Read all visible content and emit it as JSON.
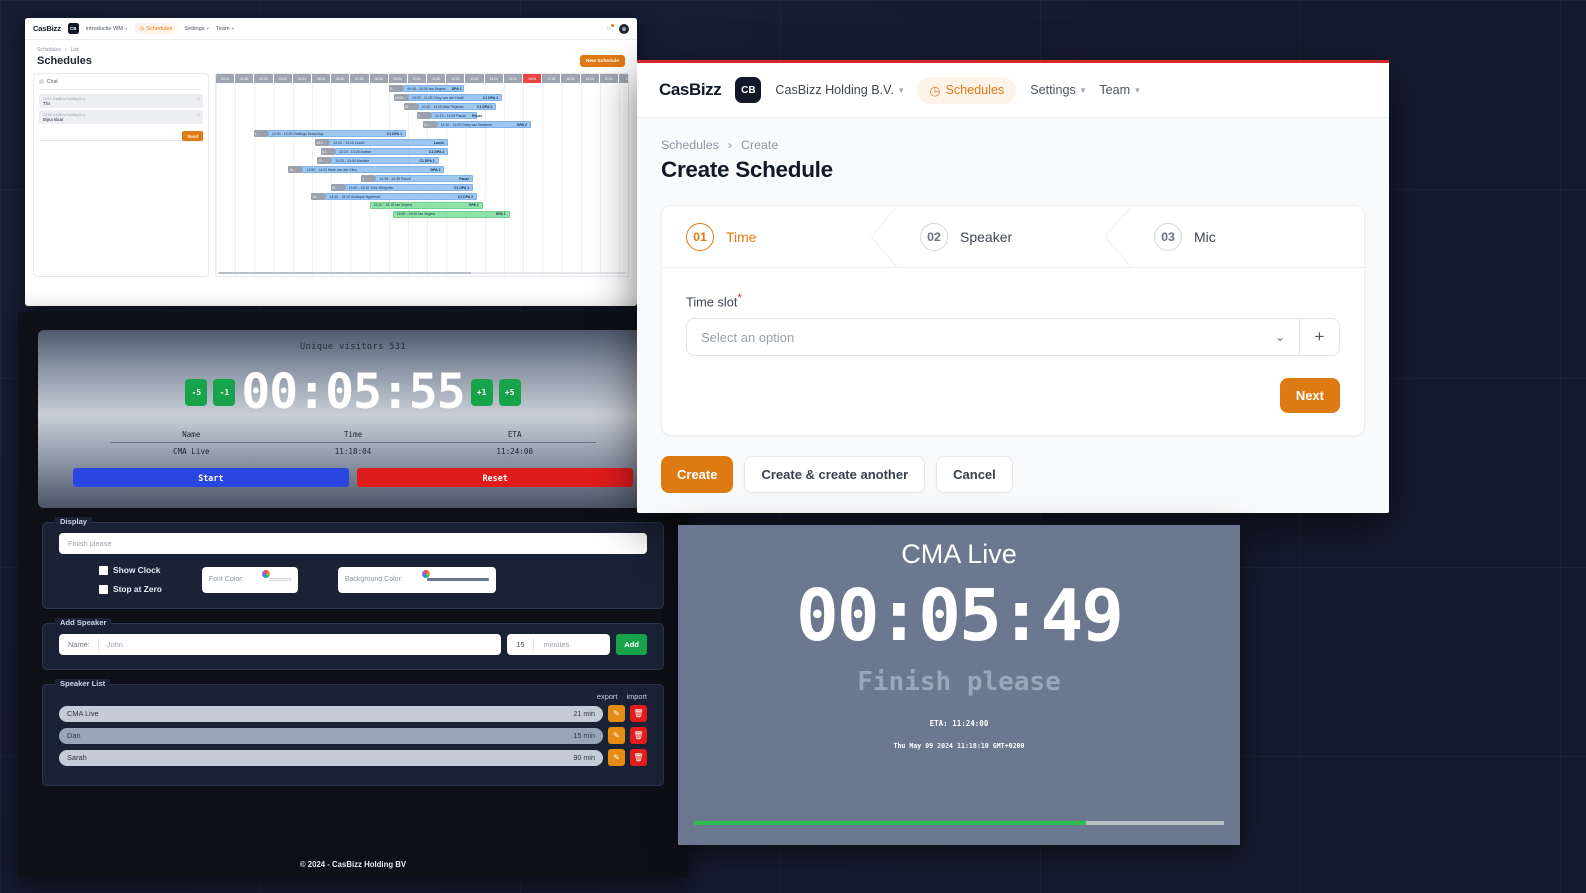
{
  "schedules_window": {
    "nav": {
      "logo": "CasBizz",
      "org_initials": "CB",
      "org_name": "introductie WM",
      "items": [
        {
          "label": "Schedules",
          "icon": "clock-icon",
          "active": true
        },
        {
          "label": "Settings",
          "icon": "chevron-down-icon",
          "active": false
        },
        {
          "label": "Team",
          "icon": "chevron-down-icon",
          "active": false
        }
      ],
      "bell_icon": "bell-icon",
      "avatar_icon": "avatar-icon"
    },
    "breadcrumb": [
      "Schedules",
      "List"
    ],
    "page_title": "Schedules",
    "new_button": "New Schedule",
    "chat": {
      "header": "Chat",
      "messages": [
        {
          "meta": "12:17 CasBizz Holding B.V.",
          "text": "Thx"
        },
        {
          "meta": "12:59 CasBizz Holding B.V.",
          "text": "Bijna klaar"
        }
      ],
      "send_label": "Send",
      "input_placeholder": ""
    },
    "gantt": {
      "ruler": [
        "00:00",
        "01:00",
        "02:00",
        "03:00",
        "04:00",
        "05:00",
        "06:00",
        "07:00",
        "08:00",
        "09:00",
        "10:00",
        "11:00",
        "12:00",
        "13:00",
        "14:00",
        "15:00",
        "16:05",
        "17:00",
        "18:00",
        "19:00",
        "20:00",
        "21:"
      ],
      "now_tick_index": 16,
      "rows": [
        {
          "label": "09:45 - 10:00 Ian Segers",
          "room": "DPA 1",
          "start": 9.75,
          "end": 12.9,
          "color": "blue",
          "handle": "0..."
        },
        {
          "label": "10:00 - 11:00 Choy van der Hooft",
          "room": "C1 DPA 1",
          "start": 10.0,
          "end": 14.9,
          "color": "blue",
          "handle": "10:00…"
        },
        {
          "label": "10:50 - 11:00 Alan Teljkovic",
          "room": "C1 DPA 2",
          "start": 10.5,
          "end": 14.6,
          "color": "blue",
          "handle": "10:…"
        },
        {
          "label": "11:15 - 11:30 Pauze",
          "room": "Pauze",
          "start": 11.2,
          "end": 13.6,
          "color": "blue",
          "handle": "1…"
        },
        {
          "label": "11:30 - 12:00 Gaby van Kesteren",
          "room": "DPA 2",
          "start": 11.5,
          "end": 16.4,
          "color": "blue",
          "handle": "11:…"
        },
        {
          "label": "12:00 - 12:20 Soelingo Rosschop",
          "room": "C1 DPA 1",
          "start": 2.7,
          "end": 9.9,
          "color": "blue",
          "handle": "1…"
        },
        {
          "label": "12:20 - 13:10 Lunch",
          "room": "Lunch",
          "start": 5.9,
          "end": 12.1,
          "color": "blue",
          "handle": "13:2…"
        },
        {
          "label": "13:10 - 13:20 Anieke",
          "room": "C1 DPA 2",
          "start": 6.2,
          "end": 12.1,
          "color": "blue",
          "handle": "13…"
        },
        {
          "label": "13:20 - 13:50 Marieke",
          "room": "C1 DPA 1",
          "start": 6.0,
          "end": 11.6,
          "color": "blue",
          "handle": "13:…"
        },
        {
          "label": "13:50 - 14:20 Mark van der Vlies",
          "room": "DPA 2",
          "start": 4.5,
          "end": 11.9,
          "color": "blue",
          "handle": "15…"
        },
        {
          "label": "14:25 - 14:35 Pauze",
          "room": "Pauze",
          "start": 8.3,
          "end": 13.4,
          "color": "blue",
          "handle": "1"
        },
        {
          "label": "14:40 - 15:10 Joris Werpelen",
          "room": "C1 DPA 1",
          "start": 6.7,
          "end": 13.4,
          "color": "blue",
          "handle": "14…"
        },
        {
          "label": "14:40 - 15:10 Siddique Ngadimin",
          "room": "C1 DPA 2",
          "start": 5.7,
          "end": 13.6,
          "color": "blue",
          "handle": "14…"
        },
        {
          "label": "15:10 - 15:15 Ian Segers",
          "room": "DPA 1",
          "start": 8.0,
          "end": 13.9,
          "color": "green",
          "handle": ""
        },
        {
          "label": "15:50 - 16:00 Ian Segers",
          "room": "DPA 1",
          "start": 9.2,
          "end": 15.3,
          "color": "green",
          "handle": ""
        }
      ]
    }
  },
  "timer_window": {
    "hero": {
      "visitors_label": "Unique visitors 531",
      "minus5": "-5",
      "minus1": "-1",
      "time": "00:05:55",
      "plus1": "+1",
      "plus5": "+5",
      "table_headers": [
        "Name",
        "Time",
        "ETA"
      ],
      "table_row": [
        "CMA Live",
        "11:18:04",
        "11:24:00"
      ],
      "start_label": "Start",
      "reset_label": "Reset"
    },
    "display": {
      "legend": "Display",
      "message_value": "Finish please",
      "show_clock_label": "Show Clock",
      "stop_at_zero_label": "Stop at Zero",
      "font_color_label": "Font Color:",
      "background_color_label": "Background Color:",
      "font_color_value": "#ffffff",
      "background_color_value": "#6b7890"
    },
    "add_speaker": {
      "legend": "Add Speaker",
      "name_label": "Name:",
      "name_placeholder": "John",
      "minutes_value": "15",
      "minutes_label": "minutes",
      "add_label": "Add"
    },
    "speaker_list": {
      "legend": "Speaker List",
      "export_label": "export",
      "import_label": "import",
      "rows": [
        {
          "name": "CMA Live",
          "minutes": "21 min"
        },
        {
          "name": "Dan",
          "minutes": "15 min"
        },
        {
          "name": "Sarah",
          "minutes": "90 min"
        }
      ],
      "edit_icon": "pencil-icon",
      "delete_icon": "trash-icon"
    },
    "footer": "© 2024 - CasBizz Holding BV"
  },
  "create_window": {
    "nav": {
      "logo": "CasBizz",
      "org_initials": "CB",
      "org_name": "CasBizz Holding B.V.",
      "items": [
        {
          "label": "Schedules",
          "icon": "clock-icon",
          "active": true
        },
        {
          "label": "Settings",
          "icon": "chevron-down-icon",
          "active": false
        },
        {
          "label": "Team",
          "icon": "chevron-down-icon",
          "active": false
        }
      ]
    },
    "breadcrumb": {
      "parent": "Schedules",
      "separator": "›",
      "current": "Create"
    },
    "page_title": "Create Schedule",
    "steps": [
      {
        "num": "01",
        "label": "Time",
        "current": true
      },
      {
        "num": "02",
        "label": "Speaker",
        "current": false
      },
      {
        "num": "03",
        "label": "Mic",
        "current": false
      }
    ],
    "form": {
      "time_slot_label": "Time slot",
      "required_mark": "*",
      "select_placeholder": "Select an option",
      "caret_icon": "chevron-down-icon",
      "add_icon": "plus-icon",
      "next_label": "Next"
    },
    "actions": {
      "create": "Create",
      "create_another": "Create & create another",
      "cancel": "Cancel"
    },
    "accent_color": "#dd7b12"
  },
  "live_window": {
    "title": "CMA Live",
    "time": "00:05:49",
    "message": "Finish please",
    "eta": "ETA: 11:24:00",
    "datetime": "Thu May 09 2024 11:18:10 GMT+0200",
    "progress_percent": 74
  }
}
